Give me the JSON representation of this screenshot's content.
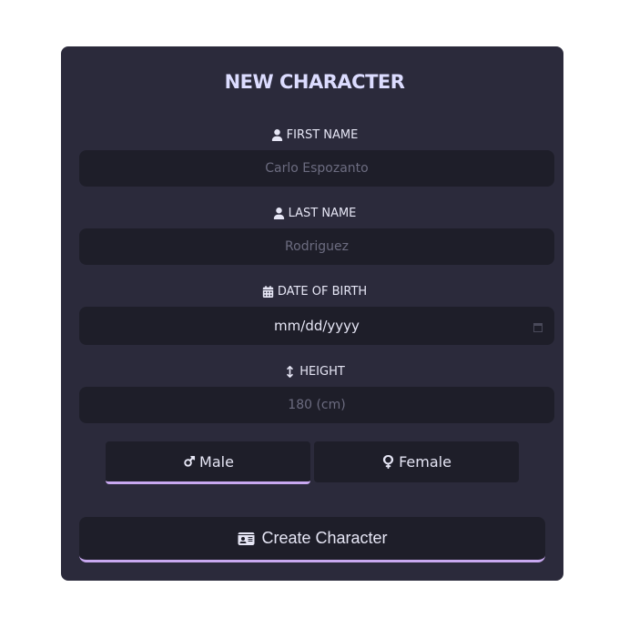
{
  "form": {
    "title": "NEW CHARACTER",
    "first_name": {
      "label": "FIRST NAME",
      "placeholder": "Carlo Espozanto",
      "icon": "user-icon"
    },
    "last_name": {
      "label": "LAST NAME",
      "placeholder": "Rodriguez",
      "icon": "user-icon"
    },
    "dob": {
      "label": "DATE OF BIRTH",
      "value": "mm/dd/yyyy",
      "icon": "calendar-icon"
    },
    "height": {
      "label": "HEIGHT",
      "placeholder": "180 (cm)",
      "icon": "arrows-vertical-icon"
    },
    "gender": {
      "male_label": "Male",
      "female_label": "Female",
      "selected": "Male"
    },
    "submit_label": "Create Character"
  },
  "colors": {
    "panel": "#2b2a3b",
    "field": "#1e1e29",
    "accent": "#c8a8f0",
    "text": "#e6e6f5",
    "title": "#dcdcff"
  }
}
